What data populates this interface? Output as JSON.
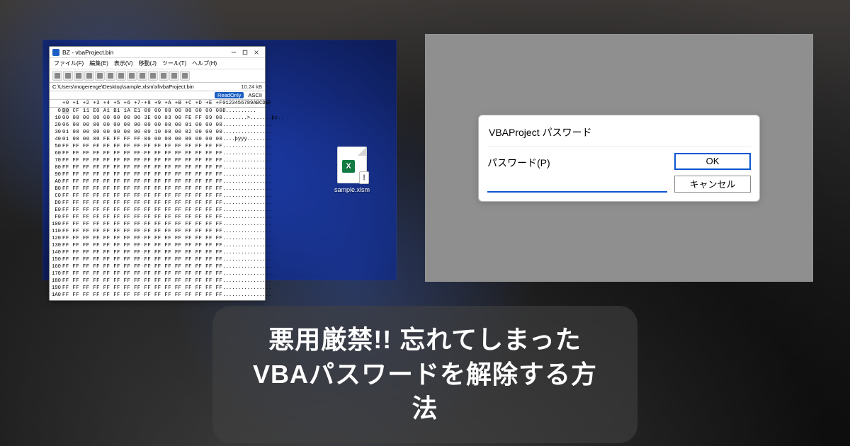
{
  "hex": {
    "window_title": "BZ - vbaProject.bin",
    "menu": [
      "ファイル(F)",
      "編集(E)",
      "表示(V)",
      "移動(J)",
      "ツール(T)",
      "ヘルプ(H)"
    ],
    "path": "C:\\Users\\mogerenge\\Desktop\\sample.xlsm\\xl\\vbaProject.bin",
    "filesize": "10.24 kB",
    "readonly_label": "ReadOnly",
    "encoding_label": "ASCII",
    "col_header": "+0 +1 +2 +3 +4 +5 +6 +7-+8 +9 +A +B +C +D +E +F",
    "ascii_header": "0123456789ABCDEF",
    "rows": [
      {
        "off": "0",
        "bytes": "D0 CF 11 E0 A1 B1 1A E1-00 00 00 00 00 00 00 00",
        "ascii": "Ð.........."
      },
      {
        "off": "10",
        "bytes": "00 00 00 00 00 00 00 00-3E 00 03 00 FE FF 09 00",
        "ascii": "........>.......þÿ.."
      },
      {
        "off": "20",
        "bytes": "06 00 00 00 00 00 00 00-00 00 00 00 01 00 00 00",
        "ascii": "................"
      },
      {
        "off": "30",
        "bytes": "01 00 00 00 00 00 00 00-00 10 00 00 02 00 00 00",
        "ascii": "................"
      },
      {
        "off": "40",
        "bytes": "01 00 00 00 FE FF FF FF-00 00 00 00 00 00 00 00",
        "ascii": "....þÿÿÿ........"
      },
      {
        "off": "50",
        "bytes": "FF FF FF FF FF FF FF FF-FF FF FF FF FF FF FF FF",
        "ascii": "................"
      },
      {
        "off": "60",
        "bytes": "FF FF FF FF FF FF FF FF-FF FF FF FF FF FF FF FF",
        "ascii": "................"
      },
      {
        "off": "70",
        "bytes": "FF FF FF FF FF FF FF FF-FF FF FF FF FF FF FF FF",
        "ascii": "................"
      },
      {
        "off": "80",
        "bytes": "FF FF FF FF FF FF FF FF-FF FF FF FF FF FF FF FF",
        "ascii": "................"
      },
      {
        "off": "90",
        "bytes": "FF FF FF FF FF FF FF FF-FF FF FF FF FF FF FF FF",
        "ascii": "................"
      },
      {
        "off": "A0",
        "bytes": "FF FF FF FF FF FF FF FF-FF FF FF FF FF FF FF FF",
        "ascii": "................"
      },
      {
        "off": "B0",
        "bytes": "FF FF FF FF FF FF FF FF-FF FF FF FF FF FF FF FF",
        "ascii": "................"
      },
      {
        "off": "C0",
        "bytes": "FF FF FF FF FF FF FF FF-FF FF FF FF FF FF FF FF",
        "ascii": "................"
      },
      {
        "off": "D0",
        "bytes": "FF FF FF FF FF FF FF FF-FF FF FF FF FF FF FF FF",
        "ascii": "................"
      },
      {
        "off": "E0",
        "bytes": "FF FF FF FF FF FF FF FF-FF FF FF FF FF FF FF FF",
        "ascii": "................"
      },
      {
        "off": "F0",
        "bytes": "FF FF FF FF FF FF FF FF-FF FF FF FF FF FF FF FF",
        "ascii": "................"
      },
      {
        "off": "100",
        "bytes": "FF FF FF FF FF FF FF FF-FF FF FF FF FF FF FF FF",
        "ascii": "................"
      },
      {
        "off": "110",
        "bytes": "FF FF FF FF FF FF FF FF-FF FF FF FF FF FF FF FF",
        "ascii": "................"
      },
      {
        "off": "120",
        "bytes": "FF FF FF FF FF FF FF FF-FF FF FF FF FF FF FF FF",
        "ascii": "................"
      },
      {
        "off": "130",
        "bytes": "FF FF FF FF FF FF FF FF-FF FF FF FF FF FF FF FF",
        "ascii": "................"
      },
      {
        "off": "140",
        "bytes": "FF FF FF FF FF FF FF FF-FF FF FF FF FF FF FF FF",
        "ascii": "................"
      },
      {
        "off": "150",
        "bytes": "FF FF FF FF FF FF FF FF-FF FF FF FF FF FF FF FF",
        "ascii": "................"
      },
      {
        "off": "160",
        "bytes": "FF FF FF FF FF FF FF FF-FF FF FF FF FF FF FF FF",
        "ascii": "................"
      },
      {
        "off": "170",
        "bytes": "FF FF FF FF FF FF FF FF-FF FF FF FF FF FF FF FF",
        "ascii": "................"
      },
      {
        "off": "180",
        "bytes": "FF FF FF FF FF FF FF FF-FF FF FF FF FF FF FF FF",
        "ascii": "................"
      },
      {
        "off": "190",
        "bytes": "FF FF FF FF FF FF FF FF-FF FF FF FF FF FF FF FF",
        "ascii": "................"
      },
      {
        "off": "1A0",
        "bytes": "FF FF FF FF FF FF FF FF-FF FF FF FF FF FF FF FF",
        "ascii": "................"
      }
    ]
  },
  "desktop_file": {
    "name": "sample.xlsm",
    "badge": "X",
    "warn": "!"
  },
  "vba": {
    "title": "VBAProject パスワード",
    "label": "パスワード(P)",
    "value": "",
    "ok": "OK",
    "cancel": "キャンセル"
  },
  "headline": {
    "line1": "悪用厳禁!! 忘れてしまった",
    "line2": "VBAパスワードを解除する方法"
  }
}
